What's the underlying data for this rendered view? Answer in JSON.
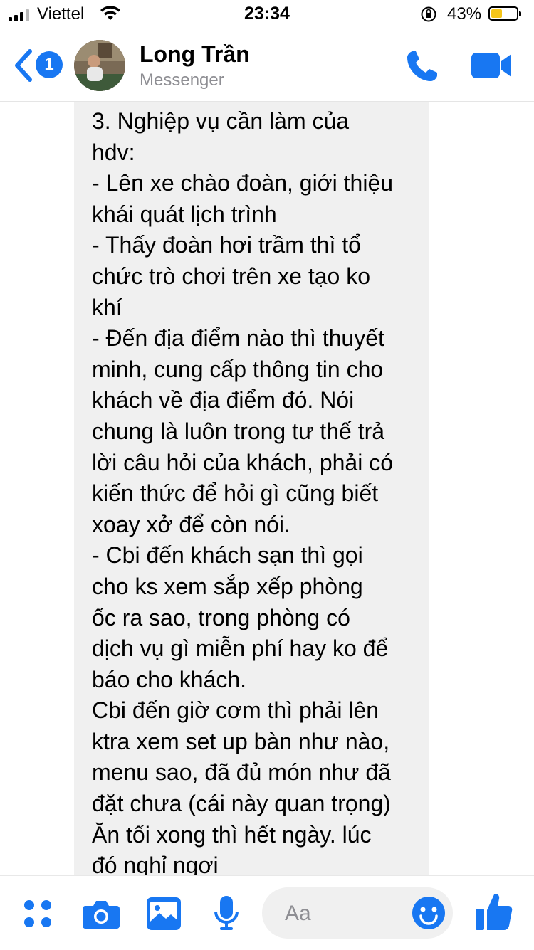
{
  "status_bar": {
    "carrier": "Viettel",
    "time": "23:34",
    "battery_percent": "43%",
    "battery_level": 0.43
  },
  "header": {
    "back_badge": "1",
    "contact_name": "Long Trần",
    "contact_subtitle": "Messenger"
  },
  "message": {
    "text": "3. Nghiệp vụ cần làm của\nhdv:\n- Lên xe chào đoàn, giới thiệu\nkhái quát lịch trình\n- Thấy đoàn hơi trầm thì tổ\nchức trò chơi trên xe tạo ko\nkhí\n- Đến địa điểm nào thì thuyết\nminh, cung cấp thông tin cho\nkhách về địa điểm đó. Nói\nchung là luôn trong tư thế trả\nlời câu hỏi của khách, phải có\nkiến thức để hỏi gì cũng biết\nxoay xở để còn nói.\n- Cbi đến khách sạn thì gọi\ncho ks xem sắp xếp phòng\nốc ra sao, trong phòng có\ndịch vụ gì miễn phí hay ko để\nbáo cho khách.\nCbi đến giờ cơm thì phải lên\nktra xem set up bàn như nào,\nmenu sao, đã đủ món như đã\nđặt chưa (cái này quan trọng)\nĂn tối xong thì hết ngày. lúc\nđó nghỉ ngơi"
  },
  "composer": {
    "placeholder": "Aa"
  },
  "colors": {
    "accent": "#1877f2",
    "bubble": "#f0f0f0",
    "battery": "#f5c518"
  },
  "icons": [
    "back-chevron-icon",
    "phone-icon",
    "video-camera-icon",
    "menu-dots-icon",
    "camera-icon",
    "photo-icon",
    "microphone-icon",
    "emoji-icon",
    "thumbs-up-icon",
    "wifi-icon",
    "orientation-lock-icon"
  ]
}
